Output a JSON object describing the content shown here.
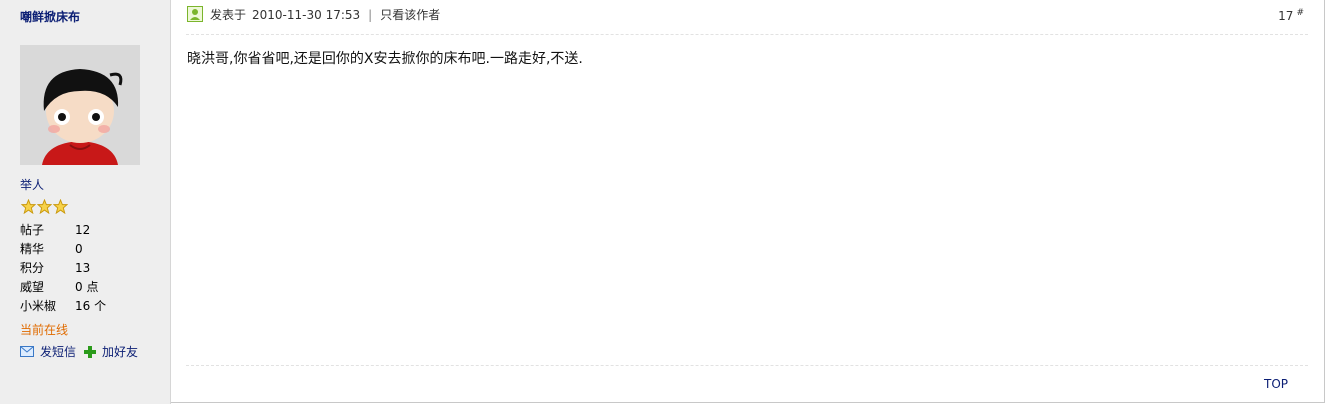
{
  "author": {
    "username": "嘲鲜掀床布",
    "title": "举人",
    "star_count": 3,
    "stats": [
      {
        "label": "帖子",
        "value": "12"
      },
      {
        "label": "精华",
        "value": "0"
      },
      {
        "label": "积分",
        "value": "13"
      },
      {
        "label": "威望",
        "value": "0 点"
      },
      {
        "label": "小米椒",
        "value": "16 个"
      }
    ],
    "online_status": "当前在线",
    "actions": {
      "message_label": "发短信",
      "add_friend_label": "加好友"
    }
  },
  "post": {
    "posted_prefix": "发表于",
    "posted_time": "2010-11-30 17:53",
    "separator": "|",
    "author_only_label": "只看该作者",
    "floor_number": "17",
    "floor_mark": "#",
    "content": "晓洪哥,你省省吧,还是回你的X安去掀你的床布吧.一路走好,不送."
  },
  "footer": {
    "top_label": "TOP"
  },
  "colors": {
    "sidebar_bg": "#eeeeee",
    "link_navy": "#0b1e74",
    "online_orange": "#e06b00",
    "star_gold": "#f2c200"
  }
}
